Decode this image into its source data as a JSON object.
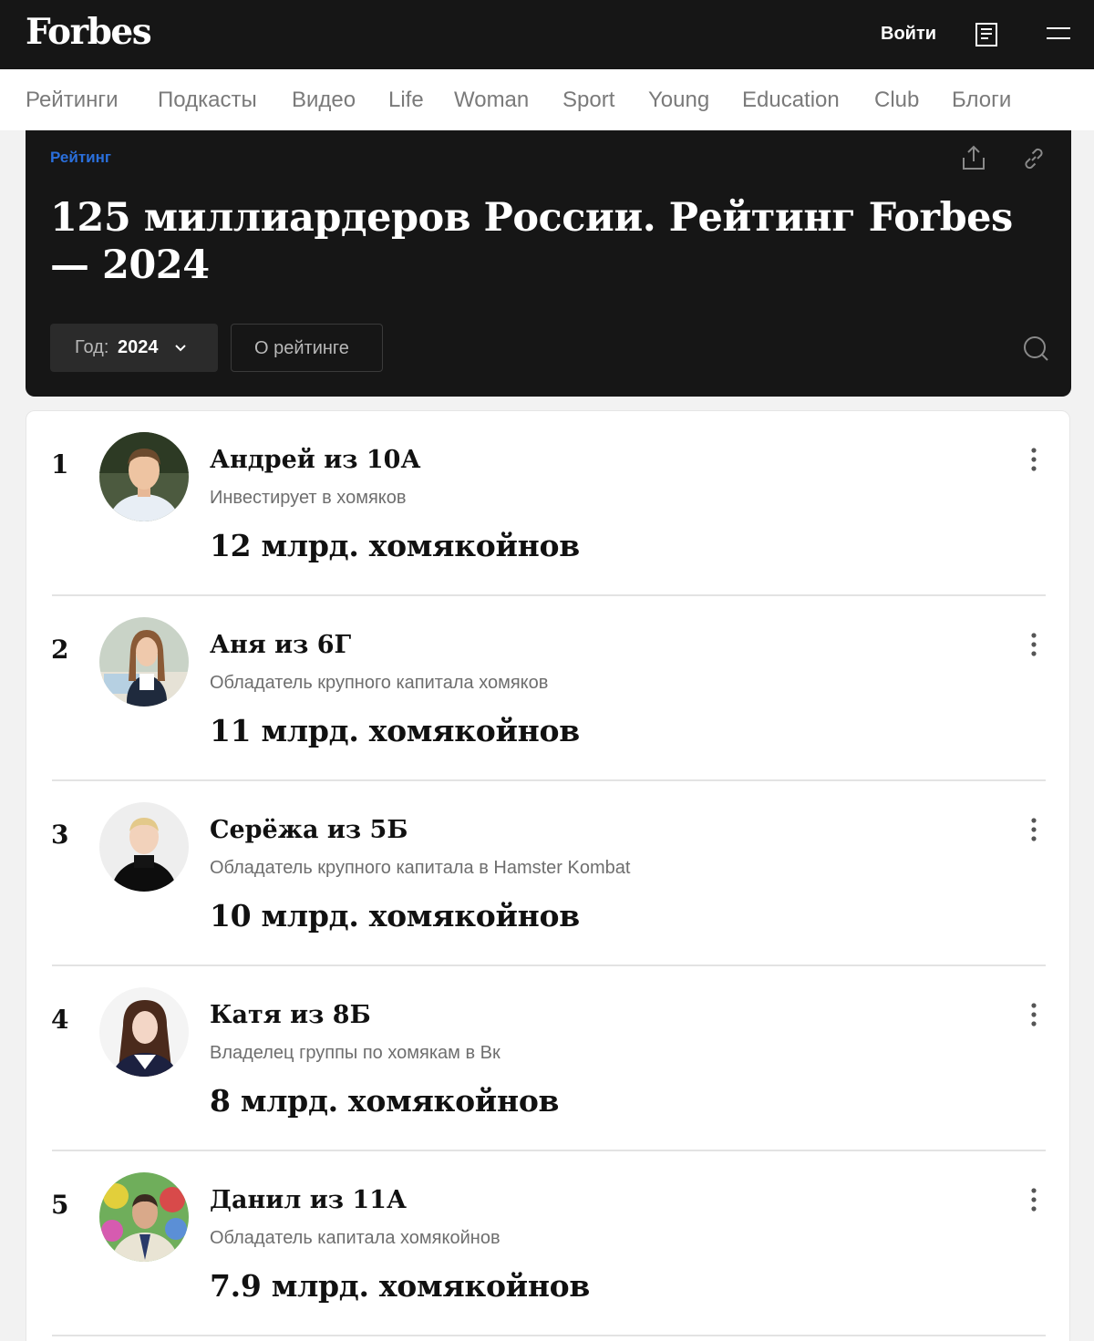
{
  "header": {
    "logo": "Forbes",
    "login_label": "Войти",
    "icons": [
      "news-icon",
      "menu-icon"
    ]
  },
  "nav": {
    "items": [
      "Рейтинги",
      "Подкасты",
      "Видео",
      "Life",
      "Woman",
      "Sport",
      "Young",
      "Education",
      "Club",
      "Блоги"
    ]
  },
  "hero": {
    "kicker": "Рейтинг",
    "title": "125 миллиардеров России. Рейтинг Forbes — 2024",
    "year_label": "Год:",
    "year_value": "2024",
    "about_label": "О рейтинге",
    "icons": [
      "share-icon",
      "link-icon",
      "search-icon",
      "chevron-down-icon"
    ]
  },
  "colors": {
    "header_bg": "#161616",
    "kicker": "#2a6fdb",
    "page_bg": "#f2f2f2"
  },
  "ranking": [
    {
      "rank": "1",
      "name": "Андрей из 10А",
      "desc": "Инвестирует в хомяков",
      "worth": "12 млрд. хомякойнов"
    },
    {
      "rank": "2",
      "name": "Аня из 6Г",
      "desc": "Обладатель крупного капитала хомяков",
      "worth": "11 млрд. хомякойнов"
    },
    {
      "rank": "3",
      "name": "Серёжа из 5Б",
      "desc": "Обладатель крупного капитала в Hamster Kombat",
      "worth": "10 млрд. хомякойнов"
    },
    {
      "rank": "4",
      "name": "Катя из 8Б",
      "desc": "Владелец группы по хомякам в Вк",
      "worth": "8 млрд. хомякойнов"
    },
    {
      "rank": "5",
      "name": "Данил из 11А",
      "desc": "Обладатель капитала хомякойнов",
      "worth": "7.9 млрд. хомякойнов"
    }
  ]
}
